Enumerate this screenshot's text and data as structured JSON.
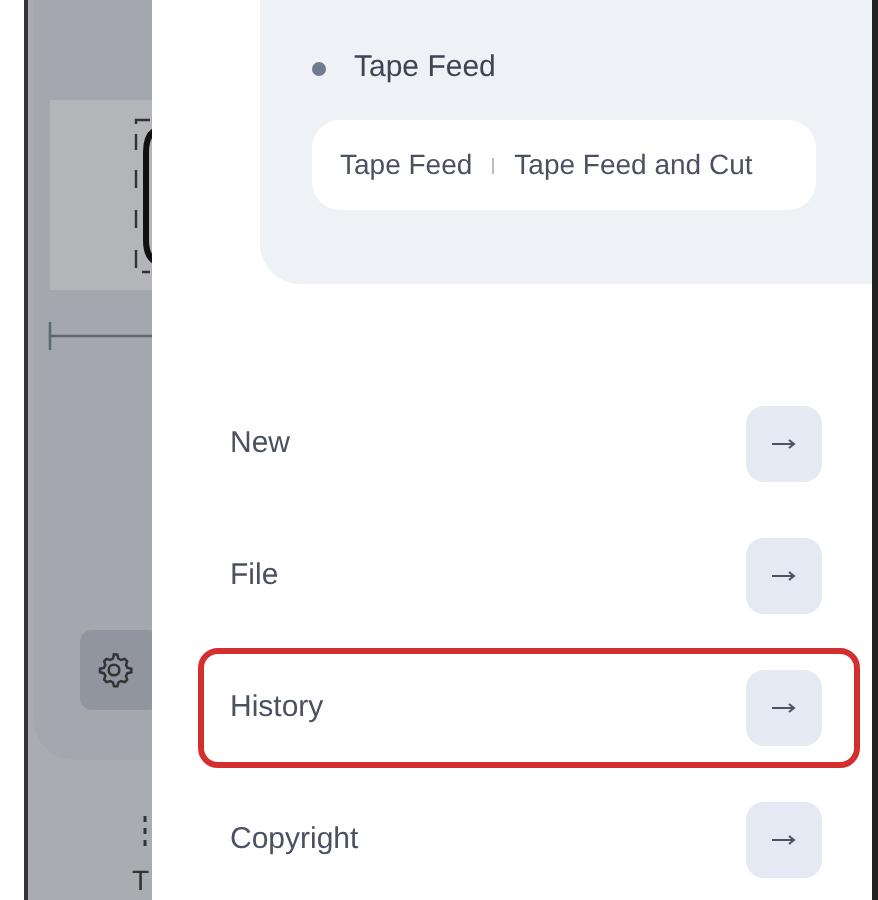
{
  "background": {
    "tab_label": "T"
  },
  "section": {
    "title": "Tape Feed",
    "options": [
      {
        "label": "Tape Feed"
      },
      {
        "label": "Tape Feed and Cut"
      }
    ]
  },
  "menu": [
    {
      "label": "New",
      "highlighted": false
    },
    {
      "label": "File",
      "highlighted": false
    },
    {
      "label": "History",
      "highlighted": true
    },
    {
      "label": "Copyright",
      "highlighted": false
    }
  ]
}
